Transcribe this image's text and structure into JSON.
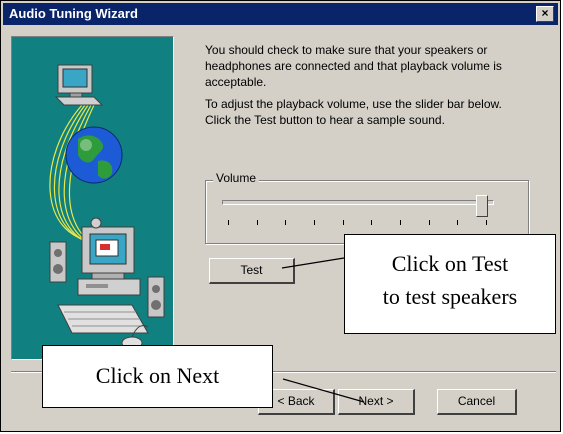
{
  "window": {
    "title": "Audio Tuning Wizard",
    "close_label": "×"
  },
  "intro": {
    "para1": "You should check to make sure that your speakers or headphones are connected and that playback volume is acceptable.",
    "para2": "To adjust the playback volume, use the slider bar below.  Click the Test button to hear a sample sound."
  },
  "volume": {
    "group_label": "Volume",
    "level": 0.98,
    "tick_count": 10
  },
  "buttons": {
    "test": "Test",
    "back": "< Back",
    "next": "Next >",
    "cancel": "Cancel"
  },
  "callouts": {
    "test_line1": "Click on Test",
    "test_line2": "to test speakers",
    "next": "Click on Next"
  },
  "colors": {
    "titlebar": "#0a246a",
    "art_background": "#118080"
  }
}
